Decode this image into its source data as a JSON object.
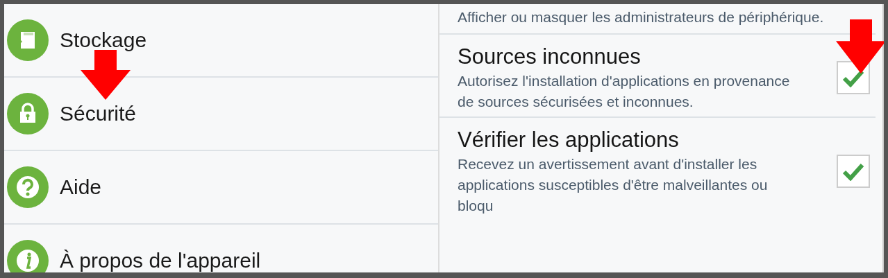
{
  "menu": [
    {
      "label": "Stockage",
      "kind": "storage",
      "selected": false
    },
    {
      "label": "Sécurité",
      "kind": "lock",
      "selected": false
    },
    {
      "label": "Aide",
      "kind": "help",
      "selected": false
    },
    {
      "label": "À propos de l'appareil",
      "kind": "info",
      "selected": false
    }
  ],
  "settings_top_text": "Afficher ou masquer les administrateurs de périphérique.",
  "settings": [
    {
      "title": "Sources inconnues",
      "description": "Autorisez l'installation d'applications en provenance de sources sécurisées et inconnues.",
      "checked": true
    },
    {
      "title": "Vérifier les applications",
      "description": "Recevez un avertissement avant d'installer les applications susceptibles d'être malveillantes ou bloqu",
      "checked": true
    }
  ]
}
